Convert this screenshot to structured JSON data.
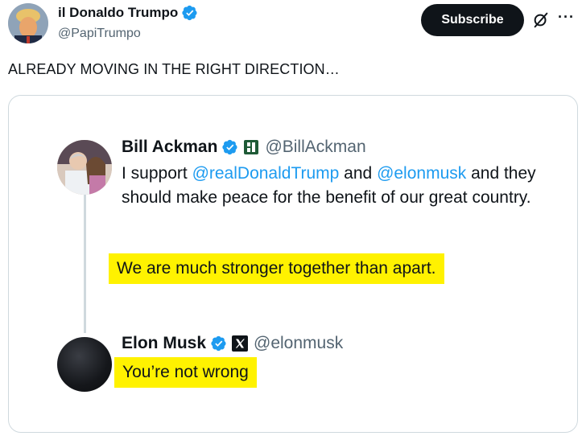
{
  "post": {
    "author": {
      "display_name": "il Donaldo Trumpo",
      "handle": "@PapiTrumpo",
      "verified": true
    },
    "subscribe_label": "Subscribe",
    "more_label": "···",
    "text": "ALREADY MOVING IN THE RIGHT DIRECTION…"
  },
  "quoted": {
    "first": {
      "name": "Bill Ackman",
      "handle": "@BillAckman",
      "body_prefix": "I support ",
      "mention1": "@realDonaldTrump",
      "body_middle": " and ",
      "mention2": "@elonmusk",
      "body_rest": " and they should make peace for the benefit of our great country.",
      "highlight": "We are much stronger together than apart."
    },
    "reply": {
      "name": "Elon Musk",
      "handle": "@elonmusk",
      "highlight": "You’re not wrong"
    }
  },
  "colors": {
    "verified": "#1d9bf0",
    "mention": "#1d9bf0",
    "highlight": "#fff200",
    "button_bg": "#0f1419"
  }
}
